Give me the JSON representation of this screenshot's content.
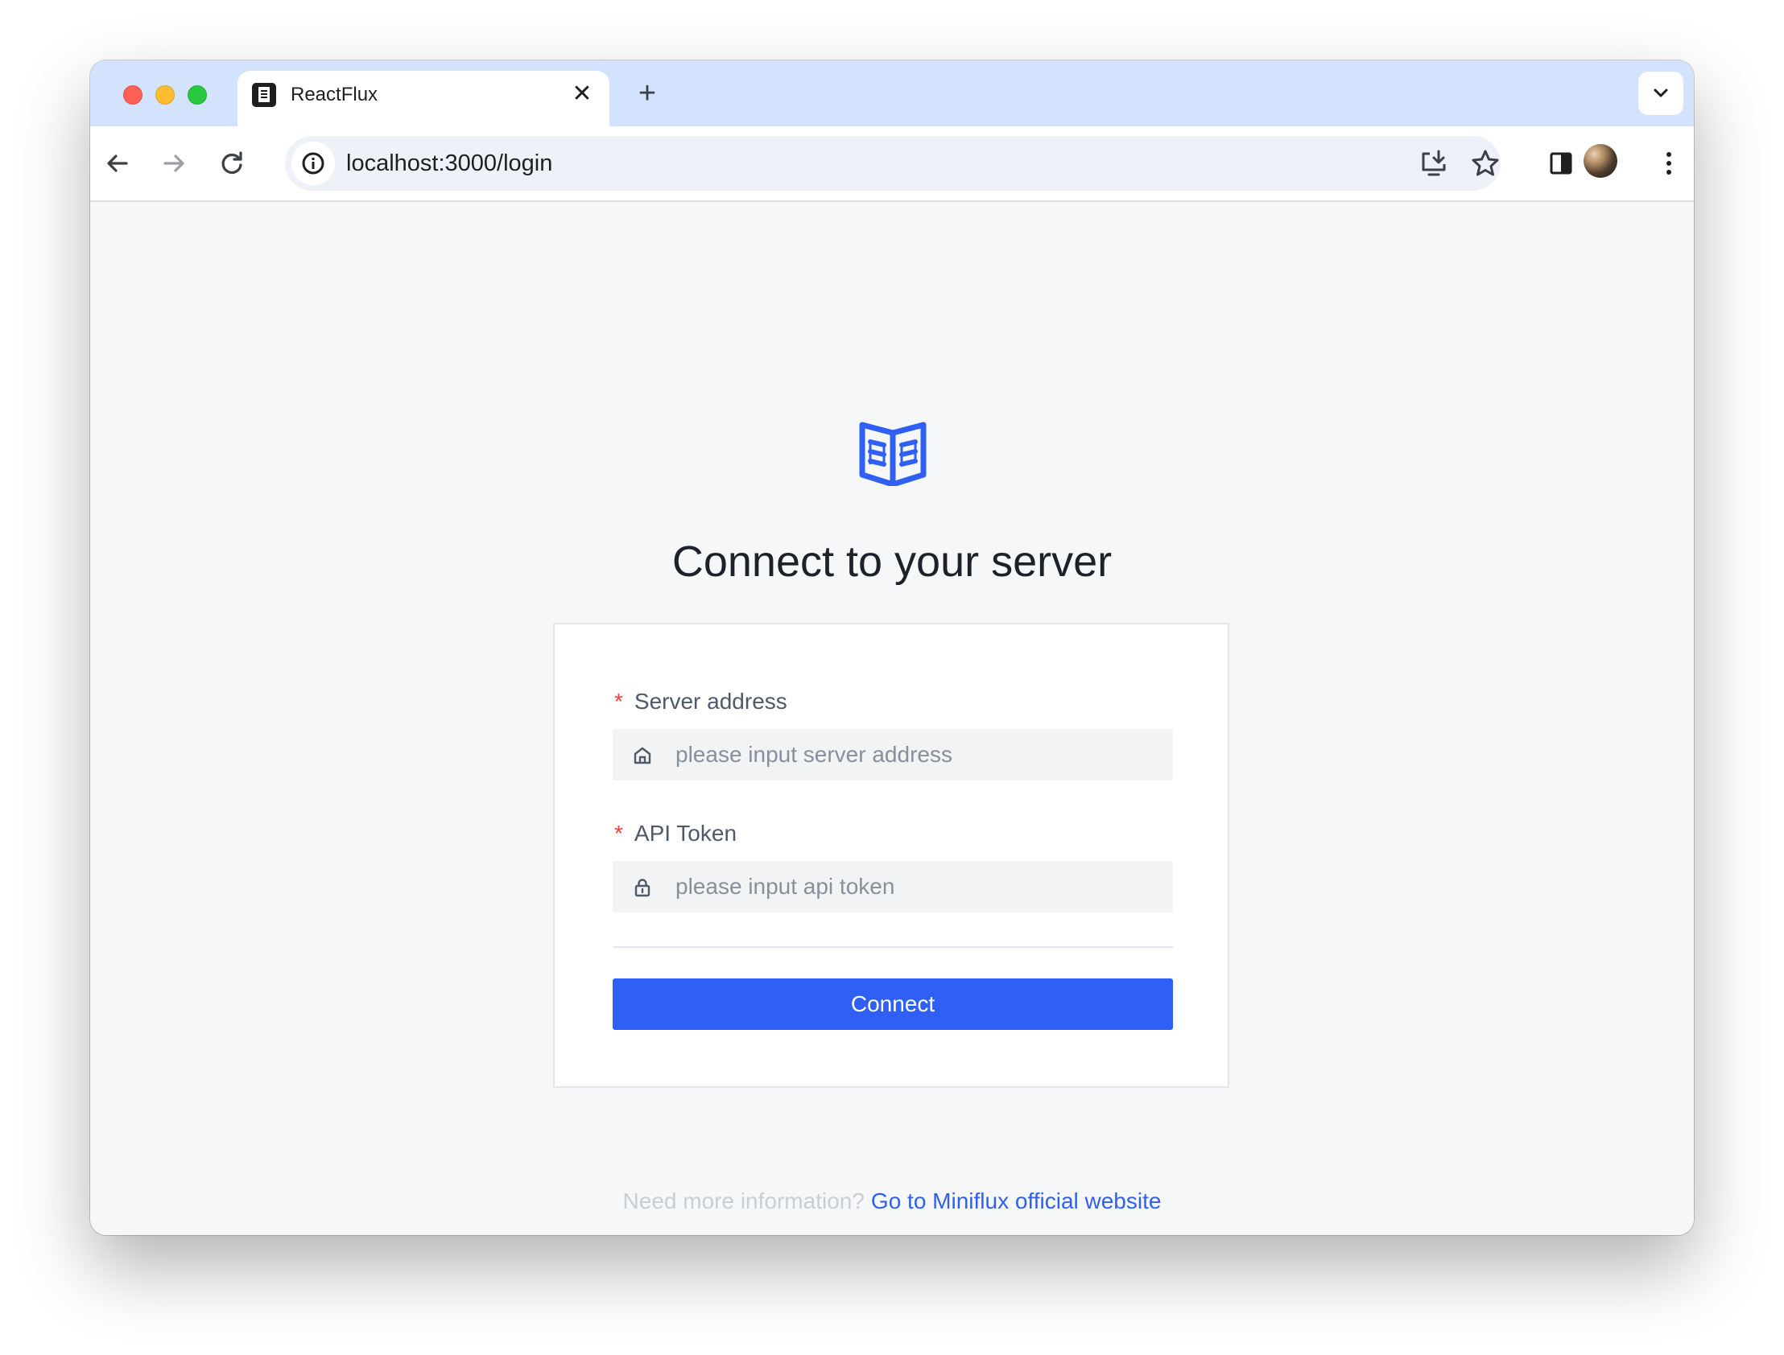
{
  "browser": {
    "tab_title": "ReactFlux",
    "tab_close": "✕",
    "new_tab": "+",
    "url": "localhost:3000/login"
  },
  "page": {
    "title": "Connect to your server",
    "server": {
      "label": "Server address",
      "required_mark": "*",
      "placeholder": "please input server address",
      "value": ""
    },
    "token": {
      "label": "API Token",
      "required_mark": "*",
      "placeholder": "please input api token",
      "value": ""
    },
    "connect_label": "Connect",
    "footer": {
      "prompt": "Need more information?",
      "link": "Go to Miniflux official website"
    }
  },
  "colors": {
    "primary": "#2f5ff5",
    "tabstrip": "#d3e3fd",
    "page_bg": "#f6f7f9",
    "required": "#f53f3f"
  },
  "icons": [
    "back-arrow-icon",
    "forward-arrow-icon",
    "reload-icon",
    "site-info-icon",
    "install-app-icon",
    "bookmark-star-icon",
    "side-panel-icon",
    "menu-dots-icon",
    "open-book-logo-icon",
    "home-icon",
    "lock-icon"
  ]
}
